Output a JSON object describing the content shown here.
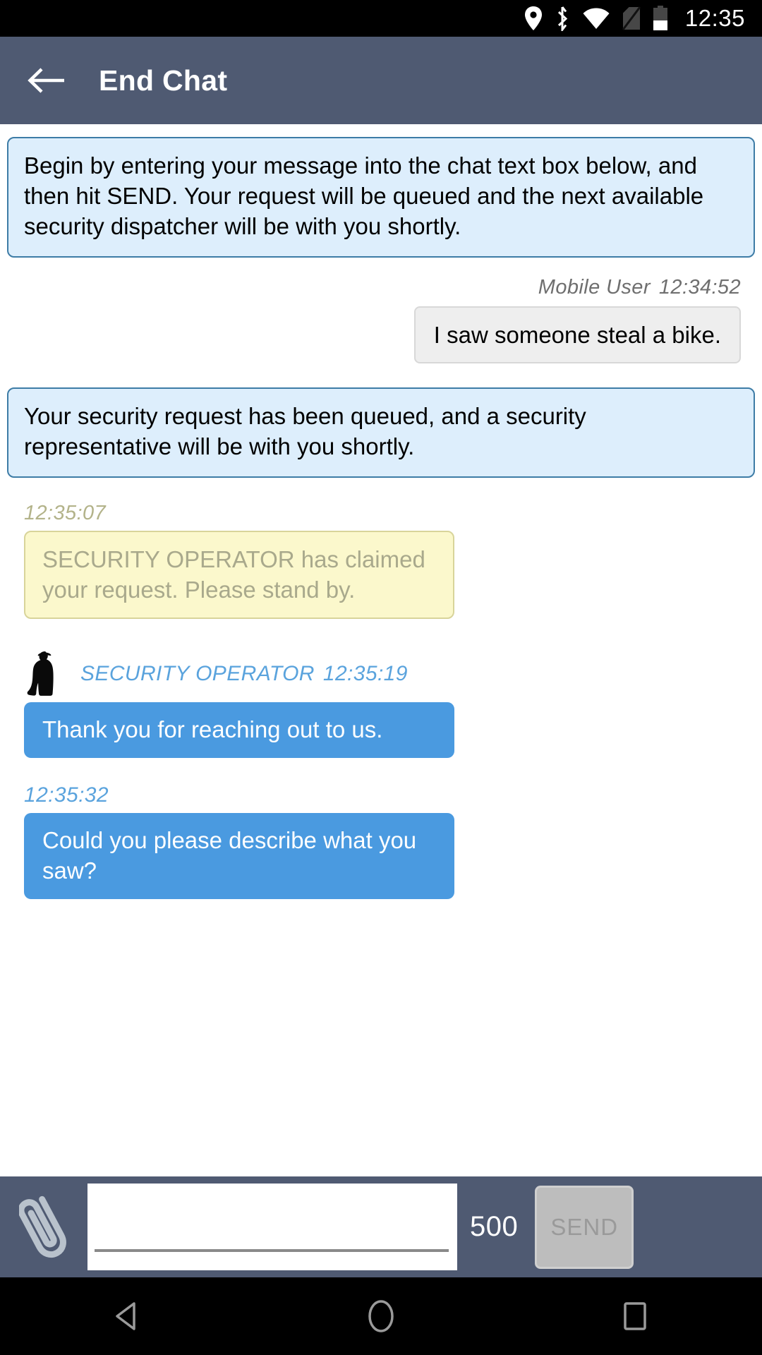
{
  "status_bar": {
    "time": "12:35",
    "icons": [
      "location-pin-icon",
      "bluetooth-icon",
      "wifi-icon",
      "no-sim-icon",
      "battery-icon"
    ]
  },
  "app_bar": {
    "title": "End Chat",
    "back_icon": "back-arrow-icon"
  },
  "chat": {
    "intro_banner": "Begin by entering your message into the chat text box below, and then hit SEND. Your request will be queued and the next available security dispatcher will be with you shortly.",
    "user_message": {
      "sender": "Mobile User",
      "time": "12:34:52",
      "text": "I saw someone steal a bike."
    },
    "queued_banner": "Your security request has been queued, and a security representative will be with you shortly.",
    "claim_notice": {
      "time": "12:35:07",
      "text": "SECURITY OPERATOR has claimed your request. Please stand by."
    },
    "operator_messages": [
      {
        "sender": "SECURITY OPERATOR",
        "time": "12:35:19",
        "text": "Thank you for reaching out to us.",
        "avatar": "security-operator-avatar"
      },
      {
        "sender": "",
        "time": "12:35:32",
        "text": "Could you please describe what you saw?",
        "avatar": ""
      }
    ]
  },
  "input_bar": {
    "attach_icon": "paperclip-icon",
    "message_value": "",
    "message_placeholder": "",
    "char_counter": "500",
    "send_label": "SEND"
  },
  "nav_bar": {
    "back_icon": "nav-back-triangle-icon",
    "home_icon": "nav-home-circle-icon",
    "recents_icon": "nav-recents-square-icon"
  },
  "colors": {
    "app_bar": "#4f5a72",
    "system_banner_bg": "#ddeefc",
    "system_banner_border": "#3d7ca6",
    "user_bubble_bg": "#eeeeee",
    "operator_bubble_bg": "#4a9ae0",
    "claim_bubble_bg": "#fbf8cc",
    "accent_blue": "#5aa3dd"
  }
}
